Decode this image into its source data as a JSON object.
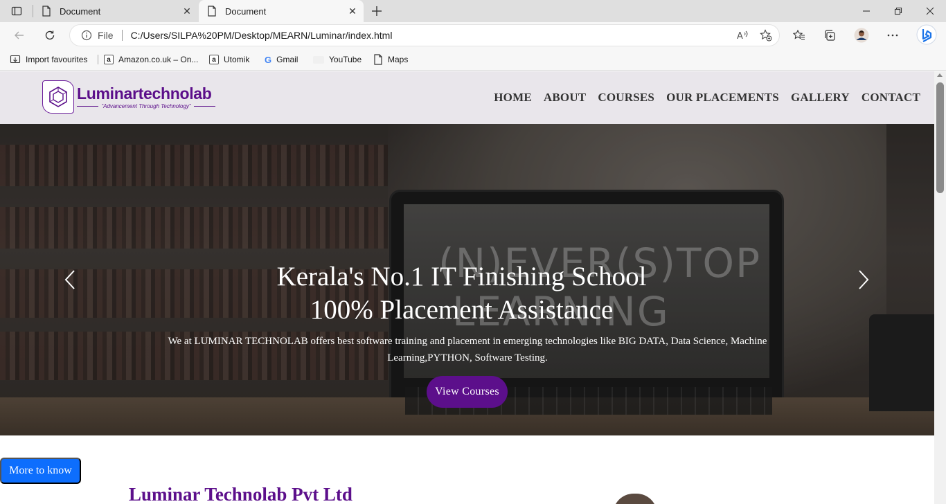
{
  "browser": {
    "tabs": [
      {
        "title": "Document",
        "active": false
      },
      {
        "title": "Document",
        "active": true
      }
    ],
    "address": {
      "scheme_label": "File",
      "url": "C:/Users/SILPA%20PM/Desktop/MEARN/Luminar/index.html"
    },
    "bookmarks": [
      {
        "label": "Import favourites",
        "icon": "import-icon"
      },
      {
        "label": "Amazon.co.uk – On...",
        "icon": "amazon-icon"
      },
      {
        "label": "Utomik",
        "icon": "amazon-icon"
      },
      {
        "label": "Gmail",
        "icon": "google-icon"
      },
      {
        "label": "YouTube",
        "icon": "youtube-icon"
      },
      {
        "label": "Maps",
        "icon": "page-icon"
      }
    ]
  },
  "site": {
    "logo": {
      "name": "Luminartechnolab",
      "tagline": "“Advancement Through Technology”"
    },
    "nav": [
      "HOME",
      "ABOUT",
      "COURSES",
      "OUR PLACEMENTS",
      "GALLERY",
      "CONTACT"
    ],
    "hero": {
      "title_line1": "Kerala's No.1 IT Finishing School",
      "title_line2": "100% Placement Assistance",
      "description": "We at LUMINAR TECHNOLAB offers best software training and placement in emerging technologies like BIG DATA, Data Science, Machine Learning,PYTHON, Software Testing.",
      "button": "View Courses",
      "chalkboard_line1": "(N)EVER(S)TOP",
      "chalkboard_line2": "LEARNING"
    },
    "more_button": "More to know",
    "company_heading": "Luminar Technolab Pvt Ltd"
  },
  "colors": {
    "brand_purple": "#5c0f8b",
    "header_bg": "#e9e6eb",
    "more_button_blue": "#0d6efd"
  }
}
